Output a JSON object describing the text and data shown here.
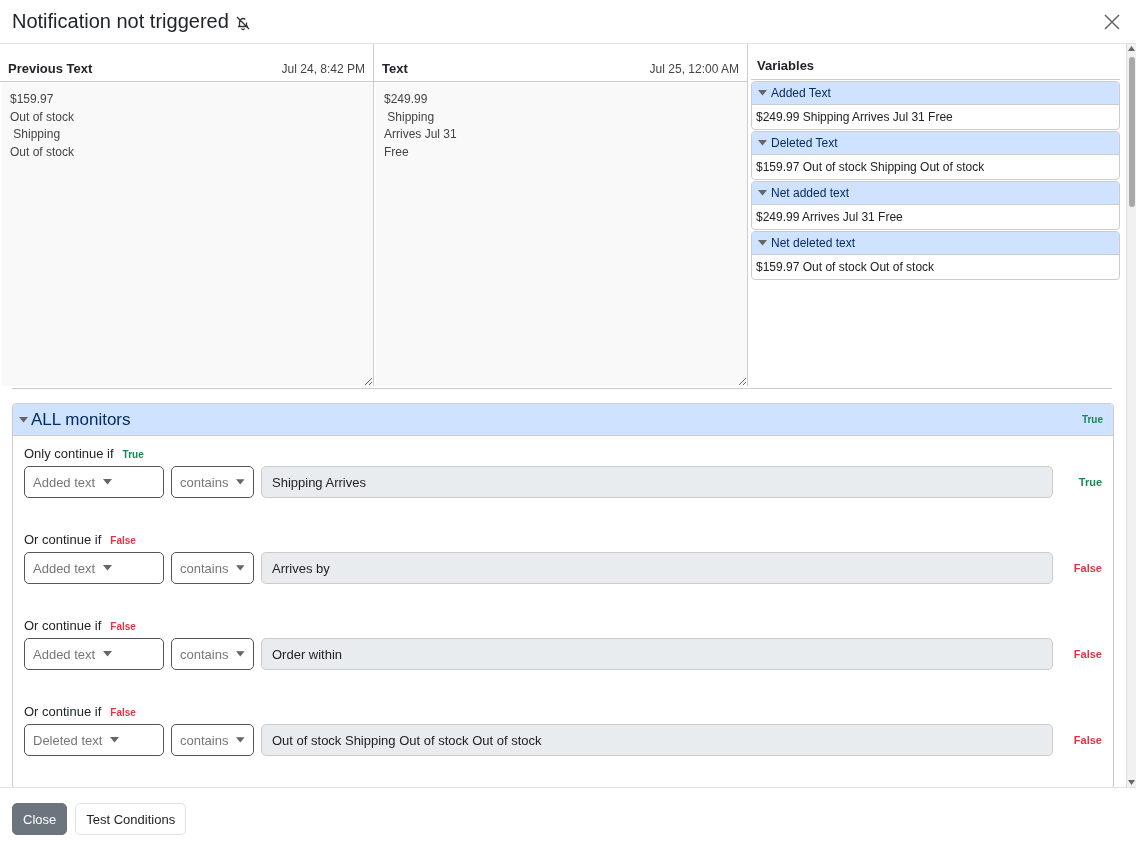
{
  "window": {
    "title": "Notification not triggered"
  },
  "previous_text": {
    "heading": "Previous Text",
    "time": "Jul 24, 8:42 PM",
    "value": "$159.97\nOut of stock\n Shipping\nOut of stock"
  },
  "text": {
    "heading": "Text",
    "time": "Jul 25, 12:00 AM",
    "value": "$249.99\n Shipping\nArrives Jul 31\nFree"
  },
  "variables": {
    "heading": "Variables",
    "items": [
      {
        "name": "Added Text",
        "expanded": true,
        "value": "$249.99 Shipping Arrives Jul 31 Free"
      },
      {
        "name": "Deleted Text",
        "expanded": true,
        "value": "$159.97 Out of stock Shipping Out of stock"
      },
      {
        "name": "Net added text",
        "expanded": true,
        "value": "$249.99 Arrives Jul 31 Free"
      },
      {
        "name": "Net deleted text",
        "expanded": true,
        "value": "$159.97 Out of stock Out of stock"
      }
    ]
  },
  "monitors": {
    "title": "ALL monitors",
    "expanded": true,
    "result": "True",
    "passed": true,
    "conditions": [
      {
        "label": "Only continue if",
        "label_result": "True",
        "label_passed": true,
        "result": "True",
        "passed": true,
        "field": "Added text",
        "operator": "contains",
        "value": "Shipping Arrives"
      },
      {
        "label": "Or continue if",
        "label_result": "False",
        "label_passed": false,
        "result": "False",
        "passed": false,
        "field": "Added text",
        "operator": "contains",
        "value": "Arrives by"
      },
      {
        "label": "Or continue if",
        "label_result": "False",
        "label_passed": false,
        "result": "False",
        "passed": false,
        "field": "Added text",
        "operator": "contains",
        "value": "Order within"
      },
      {
        "label": "Or continue if",
        "label_result": "False",
        "label_passed": false,
        "result": "False",
        "passed": false,
        "field": "Deleted text",
        "operator": "contains",
        "value": "Out of stock Shipping Out of stock Out of stock"
      }
    ]
  },
  "buttons": [
    {
      "label": "Close",
      "kind": "primary"
    },
    {
      "label": "Test Conditions",
      "kind": "secondary"
    }
  ]
}
